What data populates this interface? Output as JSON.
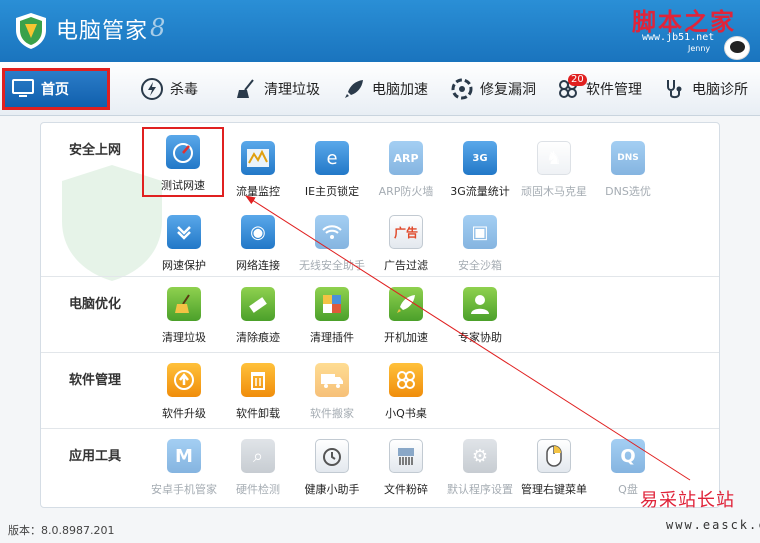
{
  "window": {
    "title": "电脑管家",
    "watermark_top": "脚本之家",
    "watermark_url": "www.jb51.net",
    "user_name": "Jenny"
  },
  "nav": {
    "tabs": [
      {
        "label": "首页",
        "icon": "monitor-icon",
        "active": true
      },
      {
        "label": "杀毒",
        "icon": "lightning-icon"
      },
      {
        "label": "清理垃圾",
        "icon": "broom-icon"
      },
      {
        "label": "电脑加速",
        "icon": "rocket-icon"
      },
      {
        "label": "修复漏洞",
        "icon": "shield-repair-icon"
      },
      {
        "label": "软件管理",
        "icon": "apps-icon",
        "badge": "20"
      },
      {
        "label": "电脑诊所",
        "icon": "stethoscope-icon"
      }
    ]
  },
  "sections": [
    {
      "title": "安全上网",
      "items": [
        {
          "label": "测试网速",
          "icon": "speedometer-icon",
          "color": "#2b86d6"
        },
        {
          "label": "流量监控",
          "icon": "chart-monitor-icon",
          "color": "#2b86d6"
        },
        {
          "label": "IE主页锁定",
          "icon": "ie-lock-icon",
          "color": "#2b86d6"
        },
        {
          "label": "ARP防火墙",
          "icon": "arp-icon",
          "color": "#2b86d6",
          "dim": true
        },
        {
          "label": "3G流量统计",
          "icon": "3g-icon",
          "color": "#2b86d6"
        },
        {
          "label": "顽固木马克星",
          "icon": "horse-icon",
          "color": "#2b86d6",
          "dim": true
        },
        {
          "label": "DNS选优",
          "icon": "dns-icon",
          "color": "#2b86d6",
          "dim": true
        },
        {
          "label": "网速保护",
          "icon": "shield-down-icon",
          "color": "#2b86d6"
        },
        {
          "label": "网络连接",
          "icon": "globe-link-icon",
          "color": "#2b86d6"
        },
        {
          "label": "无线安全助手",
          "icon": "wifi-icon",
          "color": "#2b86d6",
          "dim": true
        },
        {
          "label": "广告过滤",
          "icon": "ad-block-icon",
          "color": "#e04a2b"
        },
        {
          "label": "安全沙箱",
          "icon": "sandbox-icon",
          "color": "#2b86d6",
          "dim": true
        }
      ]
    },
    {
      "title": "电脑优化",
      "items": [
        {
          "label": "清理垃圾",
          "icon": "broom-icon"
        },
        {
          "label": "清除痕迹",
          "icon": "eraser-icon"
        },
        {
          "label": "清理插件",
          "icon": "puzzle-icon"
        },
        {
          "label": "开机加速",
          "icon": "rocket-icon"
        },
        {
          "label": "专家协助",
          "icon": "expert-icon"
        }
      ]
    },
    {
      "title": "软件管理",
      "items": [
        {
          "label": "软件升级",
          "icon": "upgrade-icon"
        },
        {
          "label": "软件卸载",
          "icon": "trash-icon"
        },
        {
          "label": "软件搬家",
          "icon": "truck-icon",
          "dim": true
        },
        {
          "label": "小Q书桌",
          "icon": "clover-icon"
        }
      ]
    },
    {
      "title": "应用工具",
      "items": [
        {
          "label": "安卓手机管家",
          "icon": "android-manager-icon",
          "dim": true
        },
        {
          "label": "硬件检测",
          "icon": "hardware-icon",
          "dim": true
        },
        {
          "label": "健康小助手",
          "icon": "alarm-clock-icon"
        },
        {
          "label": "文件粉碎",
          "icon": "shredder-icon"
        },
        {
          "label": "默认程序设置",
          "icon": "gear-icon",
          "dim": true
        },
        {
          "label": "管理右键菜单",
          "icon": "mouse-icon"
        },
        {
          "label": "Q盘",
          "icon": "q-disk-icon",
          "dim": true
        }
      ]
    }
  ],
  "footer": {
    "version": "版本：8.0.8987.201",
    "watermark": "易采站长站",
    "watermark_url": "www.easck.com"
  },
  "colors": {
    "titlebar": "#1a74be",
    "highlight": "#e02020",
    "accent": "#2b86d6"
  }
}
